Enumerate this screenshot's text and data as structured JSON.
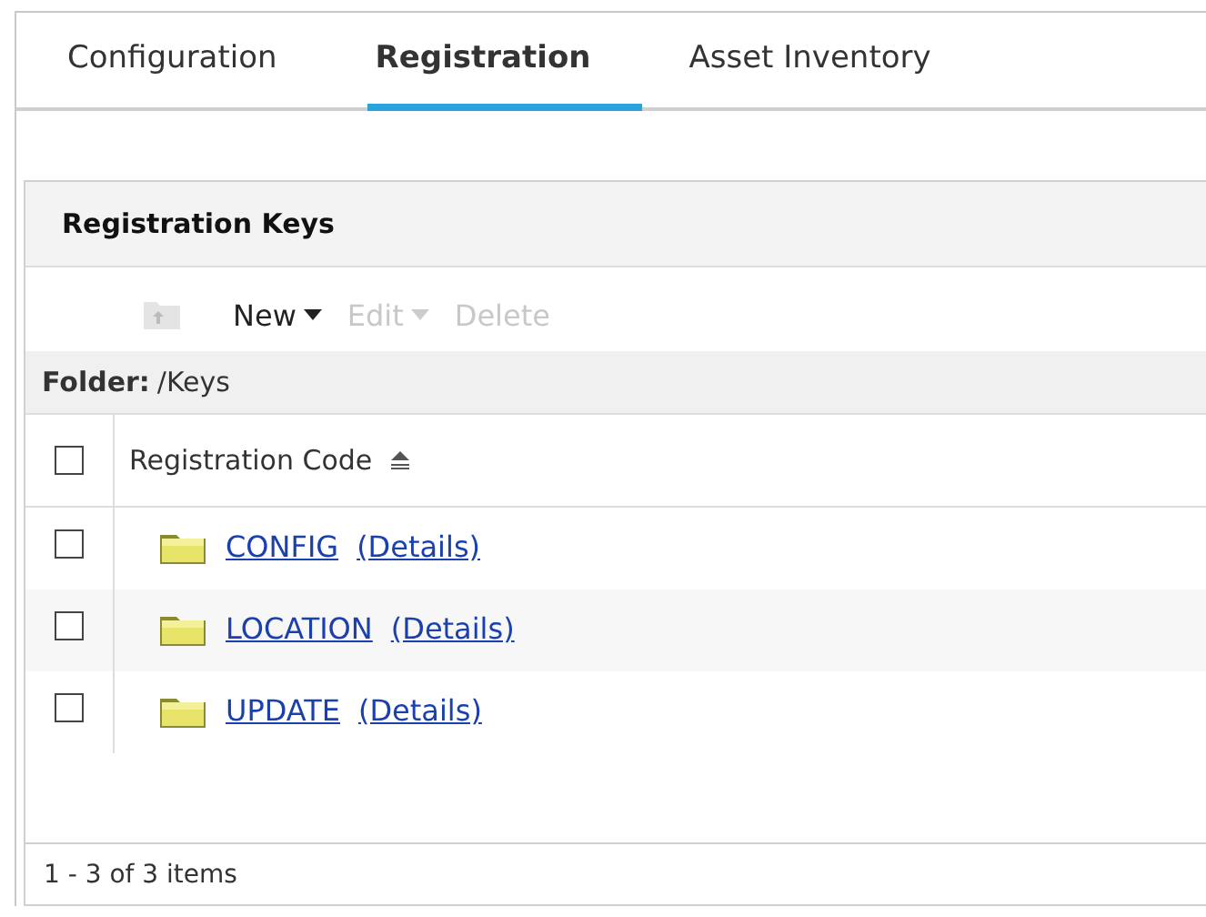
{
  "tabs": [
    {
      "label": "Configuration",
      "selected": false
    },
    {
      "label": "Registration",
      "selected": true
    },
    {
      "label": "Asset Inventory",
      "selected": false
    }
  ],
  "panel": {
    "title": "Registration Keys",
    "toolbar": [
      {
        "kind": "up-folder",
        "disabled": true
      },
      {
        "kind": "menu",
        "label": "New",
        "disabled": false
      },
      {
        "kind": "menu",
        "label": "Edit",
        "disabled": true
      },
      {
        "kind": "button",
        "label": "Delete",
        "disabled": true
      }
    ],
    "folder": {
      "label": "Folder:",
      "path": "/Keys"
    },
    "table": {
      "header_checked": false,
      "columns": [
        {
          "label": "Registration Code",
          "sorted": true
        }
      ],
      "rows": [
        {
          "checked": false,
          "name": "CONFIG",
          "details": "(Details)"
        },
        {
          "checked": false,
          "name": "LOCATION",
          "details": "(Details)"
        },
        {
          "checked": false,
          "name": "UPDATE",
          "details": "(Details)"
        }
      ]
    },
    "footer": "1 - 3 of 3 items"
  }
}
